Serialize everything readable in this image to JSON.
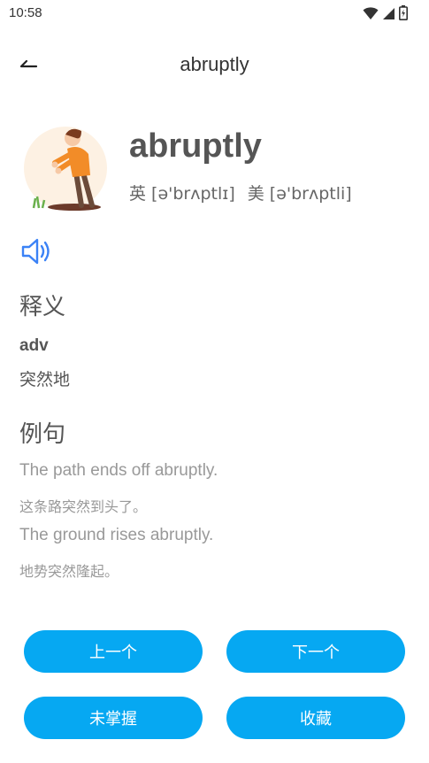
{
  "status_bar": {
    "time": "10:58"
  },
  "header": {
    "back_icon": "back-arrow-icon",
    "title": "abruptly"
  },
  "word": {
    "text": "abruptly",
    "phonetic_uk": "英 [ə'brʌptlɪ]",
    "phonetic_us": "美 [ə'brʌptli]"
  },
  "definition": {
    "section_title": "释义",
    "pos": "adv",
    "meaning": "突然地"
  },
  "examples": {
    "section_title": "例句",
    "items": [
      {
        "en": "The path ends off abruptly.",
        "zh": "这条路突然到头了。"
      },
      {
        "en": "The ground rises abruptly.",
        "zh": "地势突然隆起。"
      }
    ]
  },
  "buttons": {
    "prev": "上一个",
    "next": "下一个",
    "not_mastered": "未掌握",
    "favorite": "收藏"
  },
  "colors": {
    "accent": "#06a8f2",
    "speaker": "#3b82f6"
  }
}
